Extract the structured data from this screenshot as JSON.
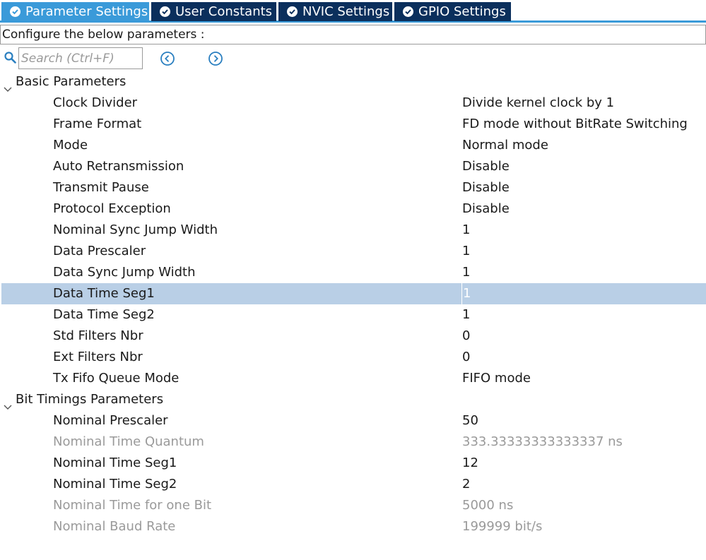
{
  "tabs": [
    {
      "label": "Parameter Settings",
      "active": true
    },
    {
      "label": "User Constants",
      "active": false
    },
    {
      "label": "NVIC Settings",
      "active": false
    },
    {
      "label": "GPIO Settings",
      "active": false
    }
  ],
  "configure_text": "Configure the below parameters :",
  "search": {
    "placeholder": "Search (Ctrl+F)",
    "value": ""
  },
  "groups": [
    {
      "title": "Basic Parameters",
      "expanded": true,
      "params": [
        {
          "name": "Clock Divider",
          "value": "Divide kernel clock by 1"
        },
        {
          "name": "Frame Format",
          "value": "FD mode without BitRate Switching"
        },
        {
          "name": "Mode",
          "value": "Normal mode"
        },
        {
          "name": "Auto Retransmission",
          "value": "Disable"
        },
        {
          "name": "Transmit Pause",
          "value": "Disable"
        },
        {
          "name": "Protocol Exception",
          "value": "Disable"
        },
        {
          "name": "Nominal Sync Jump Width",
          "value": "1"
        },
        {
          "name": "Data Prescaler",
          "value": "1"
        },
        {
          "name": "Data Sync Jump Width",
          "value": "1"
        },
        {
          "name": "Data Time Seg1",
          "value": "1",
          "selected": true
        },
        {
          "name": "Data Time Seg2",
          "value": "1"
        },
        {
          "name": "Std Filters Nbr",
          "value": "0"
        },
        {
          "name": "Ext Filters Nbr",
          "value": "0"
        },
        {
          "name": "Tx Fifo Queue Mode",
          "value": "FIFO mode"
        }
      ]
    },
    {
      "title": "Bit Timings Parameters",
      "expanded": true,
      "params": [
        {
          "name": "Nominal Prescaler",
          "value": "50"
        },
        {
          "name": "Nominal Time Quantum",
          "value": "333.33333333333337 ns",
          "readonly": true
        },
        {
          "name": "Nominal Time Seg1",
          "value": "12"
        },
        {
          "name": "Nominal Time Seg2",
          "value": "2"
        },
        {
          "name": "Nominal Time for one Bit",
          "value": "5000 ns",
          "readonly": true
        },
        {
          "name": "Nominal Baud Rate",
          "value": "199999 bit/s",
          "readonly": true
        }
      ]
    }
  ],
  "colors": {
    "tab_active": "#3a9ad9",
    "tab_inactive": "#0b2f5c",
    "selected_row": "#b9cfe6",
    "readonly_text": "#9a9a9a"
  },
  "icons": {
    "tab_status": "check-circle-icon",
    "search": "search-icon",
    "prev": "chevron-left-circle-icon",
    "next": "chevron-right-circle-icon",
    "expand": "chevron-down-icon"
  }
}
